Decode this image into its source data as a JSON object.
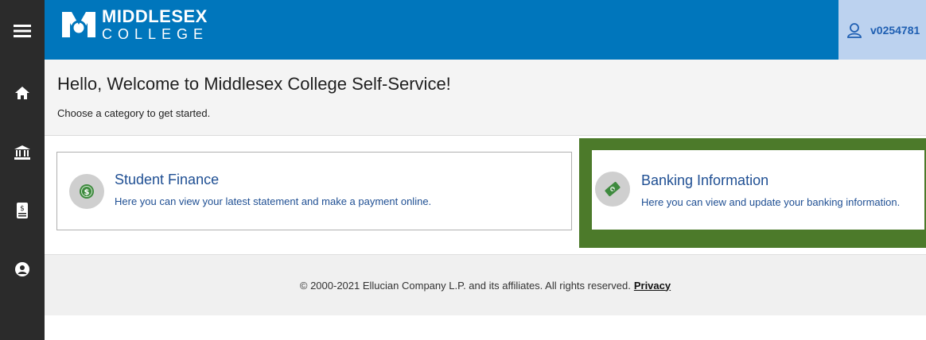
{
  "header": {
    "logo_line1": "MIDDLESEX",
    "logo_line2": "COLLEGE",
    "user_id": "v0254781",
    "brand_color": "#0076bc"
  },
  "sidebar": {
    "items": [
      {
        "icon": "hamburger-menu-icon"
      },
      {
        "icon": "home-icon"
      },
      {
        "icon": "bank-icon"
      },
      {
        "icon": "finance-document-icon"
      },
      {
        "icon": "user-profile-icon"
      }
    ]
  },
  "welcome": {
    "title": "Hello, Welcome to Middlesex College Self-Service!",
    "subtitle": "Choose a category to get started."
  },
  "cards": [
    {
      "title": "Student Finance",
      "description": "Here you can view your latest statement and make a payment online.",
      "icon": "dollar-coin-icon"
    },
    {
      "title": "Banking Information",
      "description": "Here you can view and update your banking information.",
      "icon": "money-bill-icon",
      "highlight_color": "#4c7a2a"
    }
  ],
  "footer": {
    "copyright": "© 2000-2021 Ellucian Company L.P. and its affiliates. All rights reserved.",
    "privacy_link": "Privacy"
  }
}
